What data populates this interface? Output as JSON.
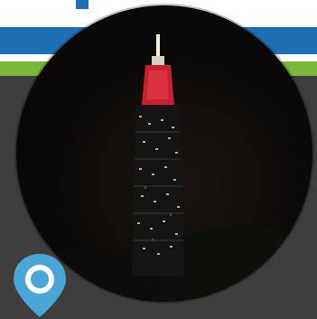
{
  "colors": {
    "blue_band": "#1e6fb3",
    "green_band": "#7ab83c",
    "dark_panel": "#3e3e3e",
    "pin_blue": "#4aa6d6"
  },
  "icons": {
    "location_pin": "map-pin-icon",
    "photo": "taipei-101-night-photo"
  }
}
